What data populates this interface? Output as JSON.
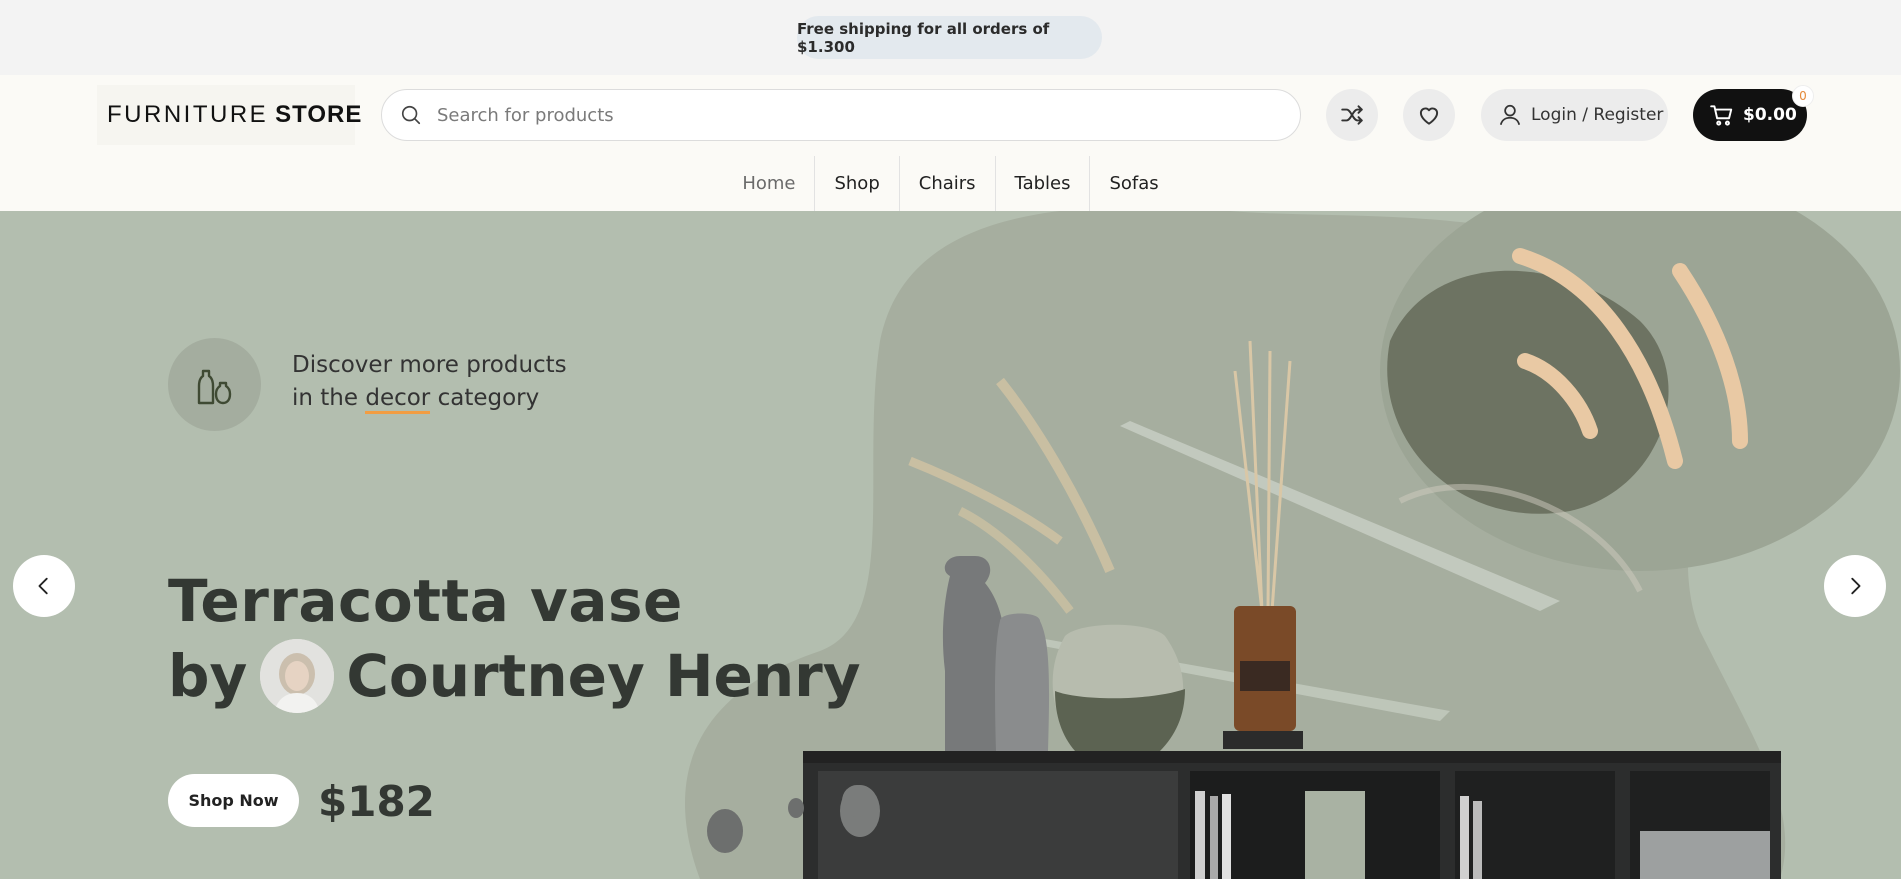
{
  "announcement": {
    "text": "Free shipping for all orders of $1.300"
  },
  "header": {
    "logo": {
      "word1": "FURNITURE",
      "word2": "STORE"
    },
    "search": {
      "placeholder": "Search for products"
    },
    "login_label": "Login / Register",
    "cart": {
      "total": "$0.00",
      "count": "0"
    }
  },
  "nav": {
    "items": [
      "Home",
      "Shop",
      "Chairs",
      "Tables",
      "Sofas"
    ]
  },
  "hero": {
    "category": {
      "line1": "Discover more products",
      "line2_pre": "in the",
      "link": "decor",
      "line2_post": "category"
    },
    "title_line1": "Terracotta vase",
    "title_by": "by",
    "title_name": "Courtney Henry",
    "shop_button": "Shop Now",
    "price": "$182"
  },
  "colors": {
    "hero_bg": "#b3beaf",
    "accent": "#f29d43",
    "cart_bg": "#111111"
  },
  "icons": [
    "search-icon",
    "compare-shuffle-icon",
    "heart-icon",
    "user-icon",
    "cart-icon",
    "vase-icon",
    "chevron-left-icon",
    "chevron-right-icon"
  ]
}
